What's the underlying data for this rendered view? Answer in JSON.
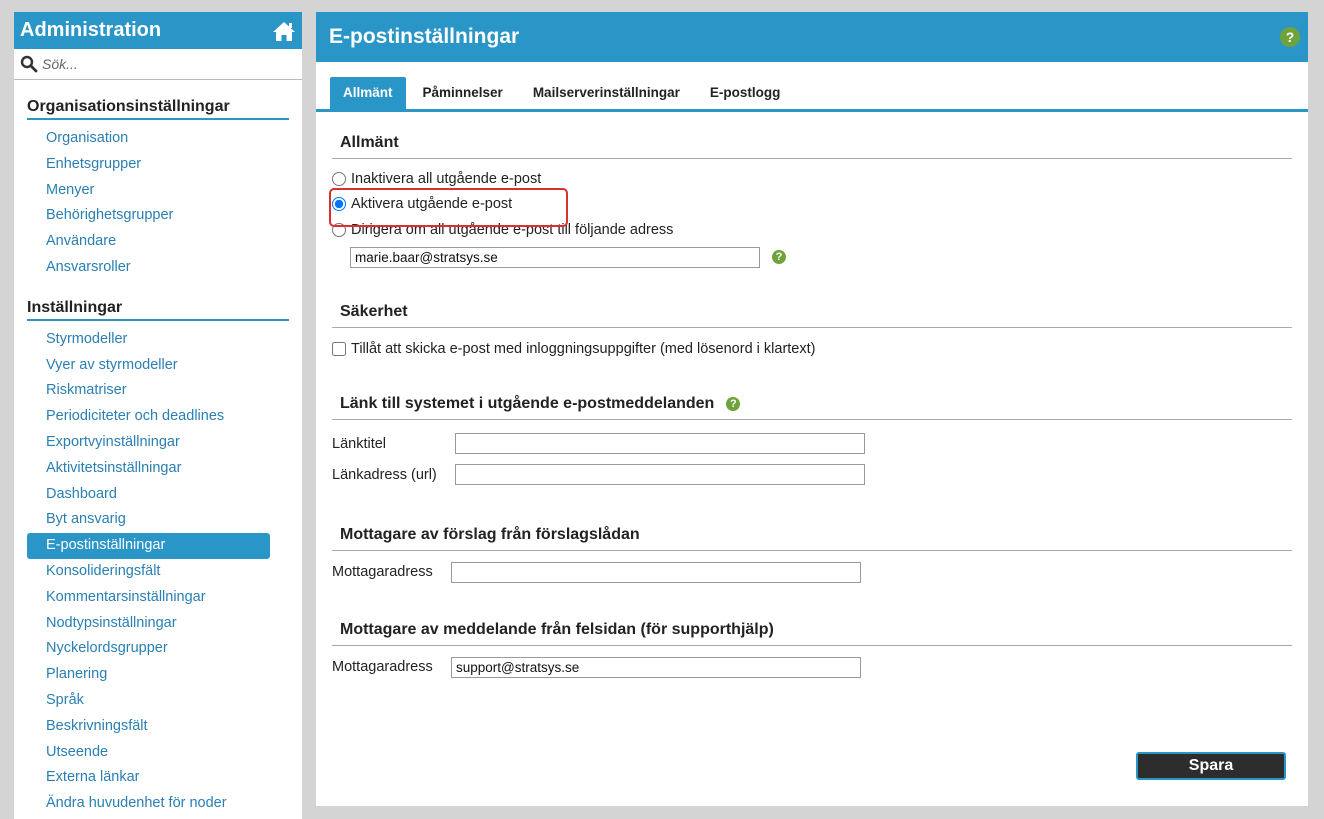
{
  "sidebar": {
    "title": "Administration",
    "search_placeholder": "Sök...",
    "sections": [
      {
        "title": "Organisationsinställningar",
        "items": [
          "Organisation",
          "Enhetsgrupper",
          "Menyer",
          "Behörighetsgrupper",
          "Användare",
          "Ansvarsroller"
        ]
      },
      {
        "title": "Inställningar",
        "items": [
          "Styrmodeller",
          "Vyer av styrmodeller",
          "Riskmatriser",
          "Periodiciteter och deadlines",
          "Exportvyinställningar",
          "Aktivitetsinställningar",
          "Dashboard",
          "Byt ansvarig",
          "E-postinställningar",
          "Konsolideringsfält",
          "Kommentarsinställningar",
          "Nodtypsinställningar",
          "Nyckelordsgrupper",
          "Planering",
          "Språk",
          "Beskrivningsfält",
          "Utseende",
          "Externa länkar",
          "Ändra huvudenhet för noder"
        ]
      }
    ],
    "active_item": "E-postinställningar"
  },
  "main": {
    "title": "E-postinställningar",
    "tabs": [
      "Allmänt",
      "Påminnelser",
      "Mailserverinställningar",
      "E-postlogg"
    ],
    "active_tab": "Allmänt",
    "general": {
      "title": "Allmänt",
      "options": [
        "Inaktivera all utgående e-post",
        "Aktivera utgående e-post",
        "Dirigera om all utgående e-post till följande adress"
      ],
      "selected": 1,
      "redirect_address": "marie.baar@stratsys.se"
    },
    "security": {
      "title": "Säkerhet",
      "checkbox_label": "Tillåt att skicka e-post med inloggningsuppgifter (med lösenord i klartext)",
      "checked": false
    },
    "link": {
      "title": "Länk till systemet i utgående e-postmeddelanden",
      "title_label": "Länktitel",
      "title_value": "",
      "url_label": "Länkadress (url)",
      "url_value": ""
    },
    "suggestions": {
      "title": "Mottagare av förslag från förslagslådan",
      "label": "Mottagaradress",
      "value": ""
    },
    "errors": {
      "title": "Mottagare av meddelande från felsidan (för supporthjälp)",
      "label": "Mottagaradress",
      "value": "support@stratsys.se"
    },
    "save_label": "Spara"
  },
  "colors": {
    "accent": "#2a96c8",
    "help": "#6da33a",
    "highlight": "#d93030"
  }
}
